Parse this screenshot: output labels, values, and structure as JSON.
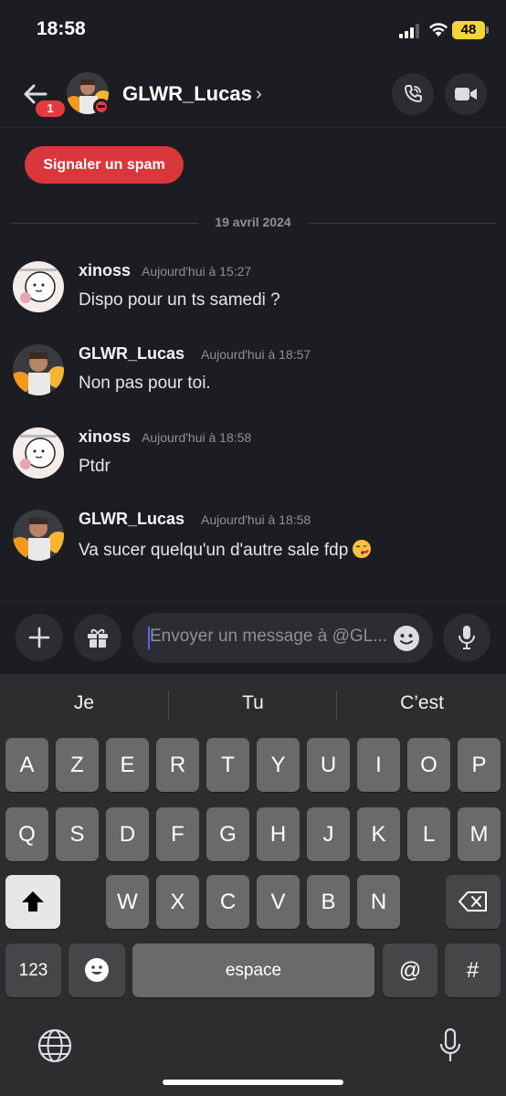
{
  "status_bar": {
    "time": "18:58",
    "battery": "48"
  },
  "header": {
    "unread_badge": "1",
    "contact_name": "GLWR_Lucas",
    "chevron": "›"
  },
  "spam_button": "Signaler un spam",
  "date_divider": "19 avril 2024",
  "messages": [
    {
      "author": "xinoss",
      "time": "Aujourd'hui à 15:27",
      "text": "Dispo pour un ts samedi ?"
    },
    {
      "author": "GLWR_Lucas",
      "time": "Aujourd'hui à 18:57",
      "text": "Non pas pour toi."
    },
    {
      "author": "xinoss",
      "time": "Aujourd'hui à 18:58",
      "text": "Ptdr"
    },
    {
      "author": "GLWR_Lucas",
      "time": "Aujourd'hui à 18:58",
      "text": "Va sucer quelqu'un d'autre sale fdp",
      "emoji": "face-blowing-kiss"
    }
  ],
  "composer": {
    "placeholder": "Envoyer un message à @GL..."
  },
  "keyboard": {
    "suggestions": [
      "Je",
      "Tu",
      "C’est"
    ],
    "row1": [
      "A",
      "Z",
      "E",
      "R",
      "T",
      "Y",
      "U",
      "I",
      "O",
      "P"
    ],
    "row2": [
      "Q",
      "S",
      "D",
      "F",
      "G",
      "H",
      "J",
      "K",
      "L",
      "M"
    ],
    "row3": [
      "W",
      "X",
      "C",
      "V",
      "B",
      "N"
    ],
    "numbers_key": "123",
    "space_key": "espace",
    "at_key": "@",
    "hash_key": "#"
  },
  "colors": {
    "accent_red": "#da373c",
    "background": "#1c1d22",
    "keyboard_bg": "#2d2d2f"
  }
}
